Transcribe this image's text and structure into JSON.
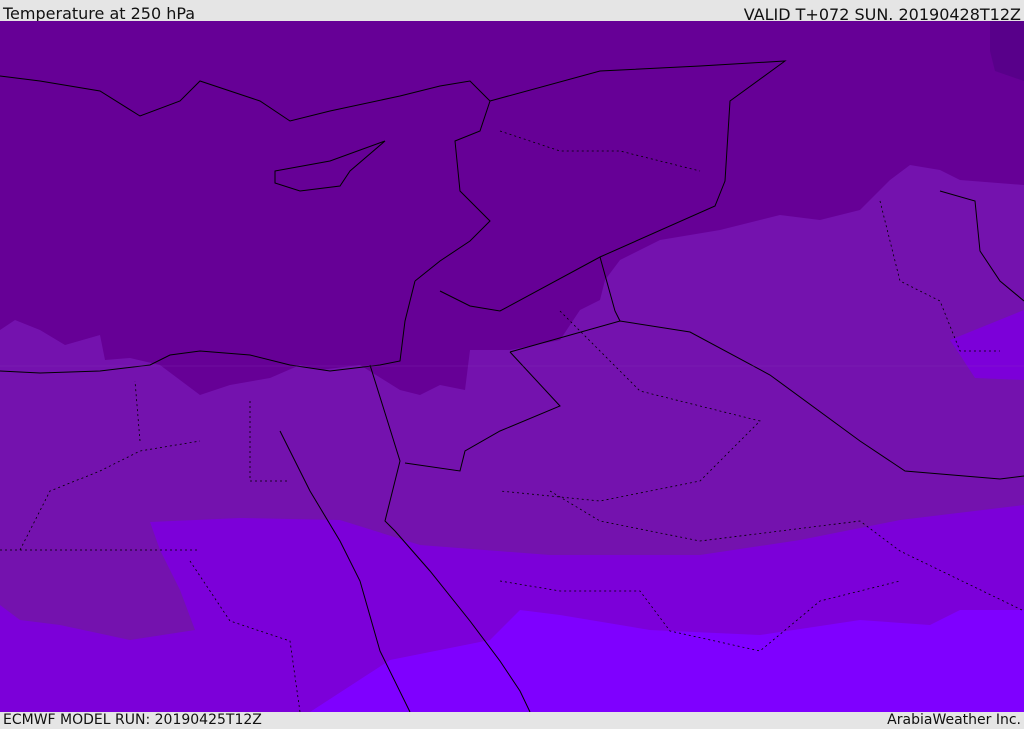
{
  "header": {
    "title": "Temperature at 250 hPa",
    "valid": "VALID T+072 SUN. 20190428T12Z"
  },
  "footer": {
    "model_run": "ECMWF MODEL RUN: 20190425T12Z",
    "credit": "ArabiaWeather Inc."
  },
  "colors": {
    "band_coldest": "#58008a",
    "band_1": "#660096",
    "band_2": "#7412ae",
    "band_3": "#7c00d9",
    "band_4": "#7f00ff",
    "border": "#000000"
  }
}
